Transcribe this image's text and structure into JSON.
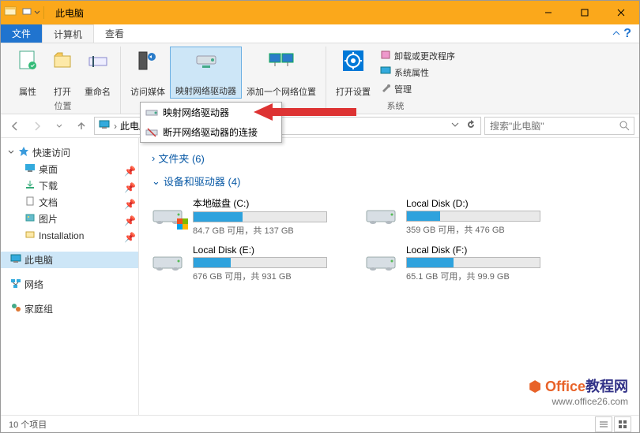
{
  "title": "此电脑",
  "tabs": {
    "file": "文件",
    "computer": "计算机",
    "view": "查看"
  },
  "ribbon": {
    "properties": "属性",
    "open": "打开",
    "rename": "重命名",
    "group_location": "位置",
    "access_media": "访问媒体",
    "map_drive": "映射网络驱动器",
    "add_location": "添加一个网络位置",
    "open_settings": "打开设置",
    "uninstall": "卸载或更改程序",
    "system_props": "系统属性",
    "manage": "管理",
    "group_system": "系统"
  },
  "dropdown": {
    "map": "映射网络驱动器",
    "disconnect": "断开网络驱动器的连接"
  },
  "breadcrumb": "此电脑",
  "search_placeholder": "搜索\"此电脑\"",
  "sidebar": {
    "quick": "快速访问",
    "items": [
      {
        "label": "桌面",
        "pinned": true
      },
      {
        "label": "下载",
        "pinned": true
      },
      {
        "label": "文档",
        "pinned": true
      },
      {
        "label": "图片",
        "pinned": true
      },
      {
        "label": "Installation",
        "pinned": true
      }
    ],
    "thispc": "此电脑",
    "network": "网络",
    "homegroup": "家庭组"
  },
  "content": {
    "folders_label": "文件夹 (6)",
    "drives_label": "设备和驱动器 (4)",
    "drives": [
      {
        "name": "本地磁盘 (C:)",
        "stats": "84.7 GB 可用，共 137 GB",
        "pct": 37
      },
      {
        "name": "Local Disk (D:)",
        "stats": "359 GB 可用，共 476 GB",
        "pct": 25
      },
      {
        "name": "Local Disk (E:)",
        "stats": "676 GB 可用，共 931 GB",
        "pct": 28
      },
      {
        "name": "Local Disk (F:)",
        "stats": "65.1 GB 可用，共 99.9 GB",
        "pct": 35
      }
    ]
  },
  "status": "10 个项目",
  "watermark": {
    "brand": "Office教程网",
    "url": "www.office26.com"
  }
}
